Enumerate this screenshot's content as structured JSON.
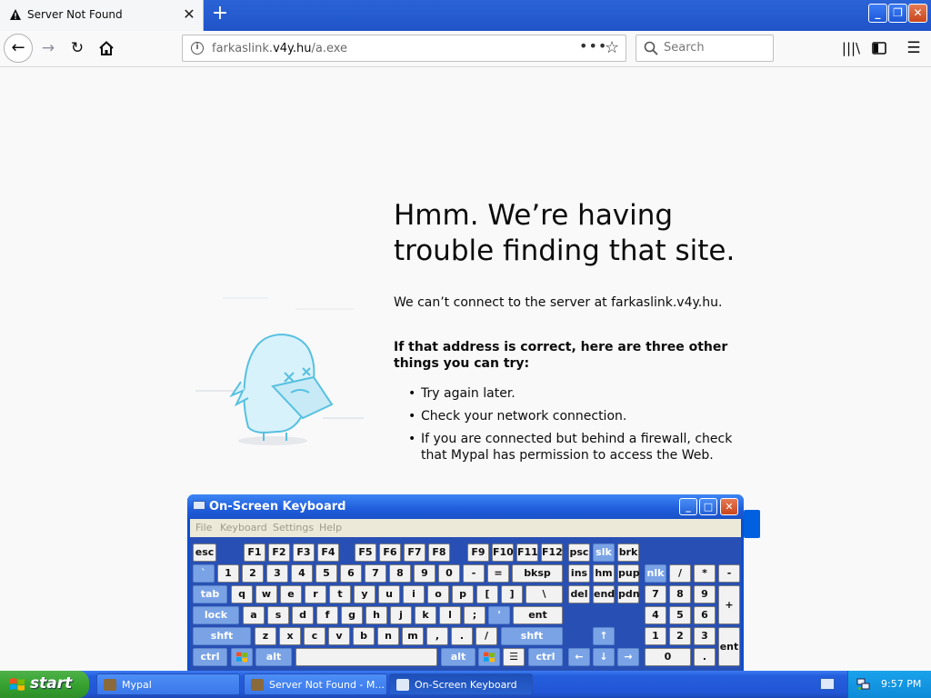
{
  "browser": {
    "tab_title": "Server Not Found",
    "tab_close": "✕",
    "new_tab": "+",
    "url_prefix": "farkaslink.",
    "url_host": "v4y.hu",
    "url_path": "/a.exe",
    "page_actions": "•••",
    "search_placeholder": "Search",
    "icons": [
      "warning-icon",
      "back-arrow-icon",
      "forward-arrow-icon",
      "reload-icon",
      "home-icon",
      "info-icon",
      "star-icon",
      "search-icon",
      "library-icon",
      "sidebar-icon",
      "hamburger-menu-icon"
    ]
  },
  "error_page": {
    "title": "Hmm. We’re having trouble finding that site.",
    "description": "We can’t connect to the server at farkaslink.v4y.hu.",
    "advice_heading": "If that address is correct, here are three other things you can try:",
    "suggestions": [
      "Try again later.",
      "Check your network connection.",
      "If you are connected but behind a firewall, check that Mypal has permission to access the Web."
    ]
  },
  "osk": {
    "title": "On-Screen Keyboard",
    "menu": [
      "File",
      "Keyboard",
      "Settings",
      "Help"
    ],
    "rows": {
      "fn": [
        "esc",
        "F1",
        "F2",
        "F3",
        "F4",
        "F5",
        "F6",
        "F7",
        "F8",
        "F9",
        "F10",
        "F11",
        "F12",
        "psc",
        "slk",
        "brk"
      ],
      "num": [
        "`",
        "1",
        "2",
        "3",
        "4",
        "5",
        "6",
        "7",
        "8",
        "9",
        "0",
        "-",
        "=",
        "bksp",
        "ins",
        "hm",
        "pup",
        "nlk",
        "/",
        "*",
        "-"
      ],
      "qwerty": [
        "tab",
        "q",
        "w",
        "e",
        "r",
        "t",
        "y",
        "u",
        "i",
        "o",
        "p",
        "[",
        "]",
        "\\",
        "del",
        "end",
        "pdn",
        "7",
        "8",
        "9",
        "+"
      ],
      "home": [
        "lock",
        "a",
        "s",
        "d",
        "f",
        "g",
        "h",
        "j",
        "k",
        "l",
        ";",
        "'",
        "ent",
        "4",
        "5",
        "6"
      ],
      "shift": [
        "shft",
        "z",
        "x",
        "c",
        "v",
        "b",
        "n",
        "m",
        ",",
        ".",
        "/",
        "shft",
        "↑",
        "1",
        "2",
        "3",
        "ent"
      ],
      "bottom": [
        "ctrl",
        "alt",
        "alt",
        "ctrl",
        "←",
        "↓",
        "→",
        "0",
        "."
      ]
    }
  },
  "taskbar": {
    "start_label": "start",
    "tasks": [
      "Mypal",
      "Server Not Found - M...",
      "On-Screen Keyboard"
    ],
    "clock": "9:57 PM"
  },
  "colors": {
    "xp_blue": "#245edc",
    "start_green": "#37a331",
    "osk_key_blue": "#7aa3e6",
    "firefox_blue": "#0060df"
  }
}
